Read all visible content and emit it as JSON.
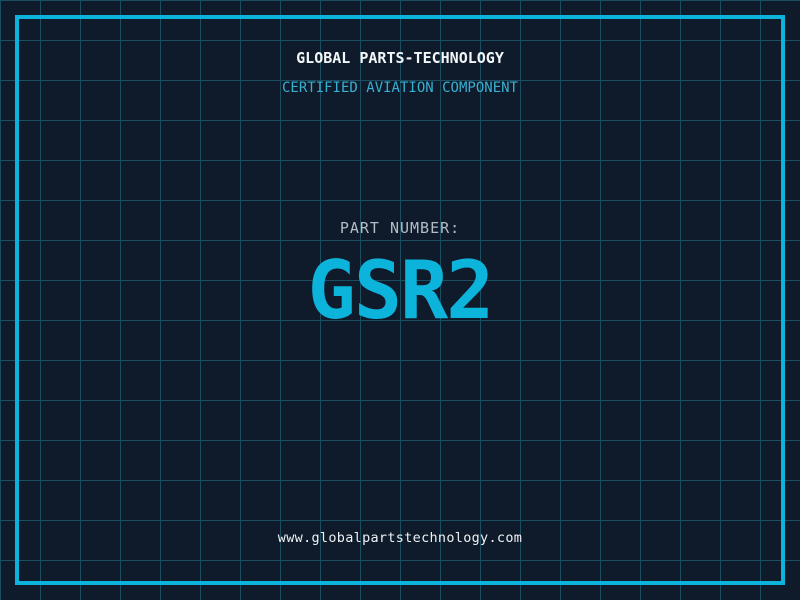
{
  "page": {
    "colors": {
      "background": "#0f1a2a",
      "grid_line": "#1a4e63",
      "frame_accent": "#0cb4dc",
      "header_white": "#f2f6f8",
      "tagline_cyan": "#38b0d2",
      "label_gray": "#b4bcc6",
      "part_number_cyan": "#0cb4dc",
      "website_white": "#eef2f5"
    }
  },
  "header": {
    "company_name": "GLOBAL PARTS-TECHNOLOGY",
    "tagline": "CERTIFIED AVIATION COMPONENT"
  },
  "part": {
    "label": "PART NUMBER:",
    "number": "GSR2"
  },
  "footer": {
    "website": "www.globalpartstechnology.com"
  }
}
